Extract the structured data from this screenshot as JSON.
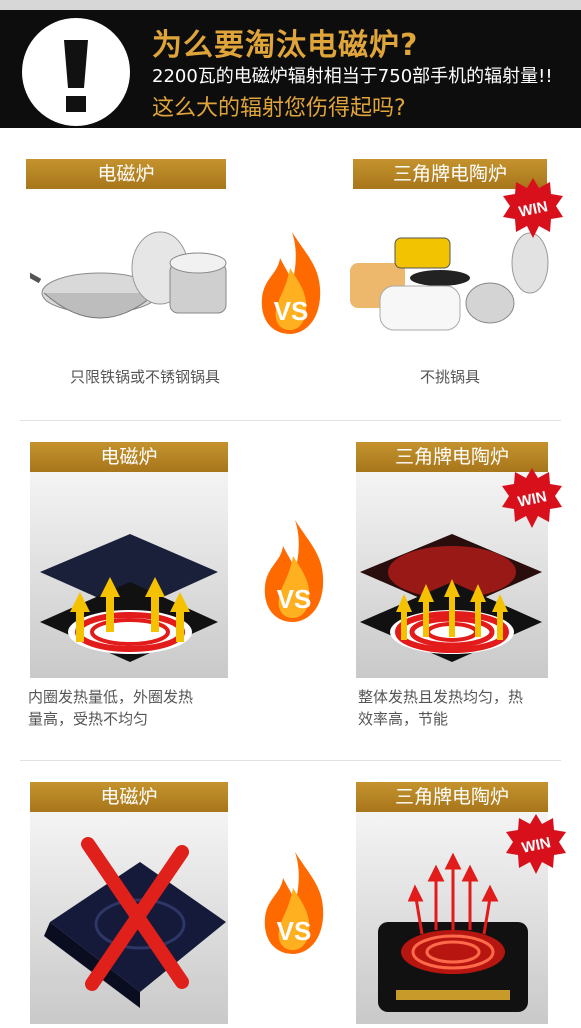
{
  "header": {
    "title": "为么要淘汰电磁炉?",
    "subtitle": "2200瓦的电磁炉辐射相当于750部手机的辐射量!!",
    "question": "这么大的辐射您伤得起吗?"
  },
  "sections": [
    {
      "left_label": "电磁炉",
      "right_label": "三角牌电陶炉",
      "left_caption": "只限铁锅或不锈钢锅具",
      "right_caption": "不挑锅具",
      "vs": "VS",
      "badge": "WIN"
    },
    {
      "left_label": "电磁炉",
      "right_label": "三角牌电陶炉",
      "left_caption_1": "内圈发热量低，外圈发热",
      "left_caption_2": "量高，受热不均匀",
      "right_caption_1": "整体发热且发热均匀，热",
      "right_caption_2": "效率高，节能",
      "vs": "VS",
      "badge": "WIN"
    },
    {
      "left_label": "电磁炉",
      "right_label": "三角牌电陶炉",
      "vs": "VS",
      "badge": "WIN"
    }
  ],
  "colors": {
    "gold": "#b8862a",
    "flame": "#ff6a00",
    "win": "#d8101c"
  }
}
